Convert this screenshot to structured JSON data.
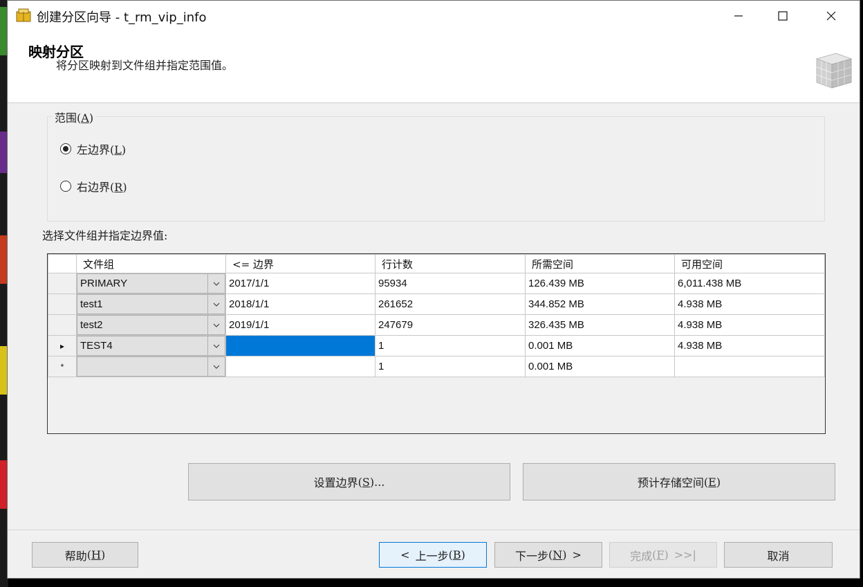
{
  "window": {
    "title": "创建分区向导 - t_rm_vip_info"
  },
  "header": {
    "title": "映射分区",
    "subtitle": "将分区映射到文件组并指定范围值。"
  },
  "range_group": {
    "label": "范围",
    "label_key": "A",
    "options": [
      {
        "label": "左边界",
        "key": "L",
        "selected": true
      },
      {
        "label": "右边界",
        "key": "R",
        "selected": false
      }
    ]
  },
  "grid_label": "选择文件组并指定边界值:",
  "grid": {
    "columns": [
      "文件组",
      "<= 边界",
      "行计数",
      "所需空间",
      "可用空间"
    ],
    "rows": [
      {
        "indicator": "",
        "filegroup": "PRIMARY",
        "boundary": "2017/1/1",
        "rows": "95934",
        "required": "126.439 MB",
        "available": "6,011.438 MB"
      },
      {
        "indicator": "",
        "filegroup": "test1",
        "boundary": "2018/1/1",
        "rows": "261652",
        "required": "344.852 MB",
        "available": "4.938 MB"
      },
      {
        "indicator": "",
        "filegroup": "test2",
        "boundary": "2019/1/1",
        "rows": "247679",
        "required": "326.435 MB",
        "available": "4.938 MB"
      },
      {
        "indicator": "▸",
        "filegroup": "TEST4",
        "boundary": "",
        "rows": "1",
        "required": "0.001 MB",
        "available": "4.938 MB"
      },
      {
        "indicator": "*",
        "filegroup": "",
        "boundary": "",
        "rows": "1",
        "required": "0.001 MB",
        "available": ""
      }
    ]
  },
  "actions": {
    "set_boundary": {
      "label": "设置边界",
      "key": "S",
      "suffix": "..."
    },
    "estimate_storage": {
      "label": "预计存储空间",
      "key": "E"
    }
  },
  "footer": {
    "help": {
      "label": "帮助",
      "key": "H"
    },
    "back": {
      "prefix": "<",
      "label": "上一步",
      "key": "B"
    },
    "next": {
      "label": "下一步",
      "key": "N",
      "suffix": ">"
    },
    "finish": {
      "label": "完成",
      "key": "F",
      "suffix": ">>|"
    },
    "cancel": {
      "label": "取消"
    }
  },
  "colors": {
    "selection": "#0078d7",
    "window_bg": "#f0f0f0"
  }
}
